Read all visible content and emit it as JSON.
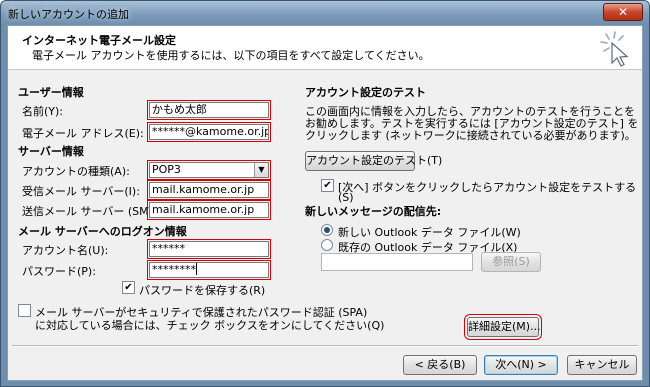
{
  "window": {
    "title": "新しいアカウントの追加",
    "close_glyph": "✕"
  },
  "header": {
    "title": "インターネット電子メール設定",
    "description": "電子メール アカウントを使用するには、以下の項目をすべて設定してください。",
    "icon": "cursor-sparkle-icon"
  },
  "user_info": {
    "heading": "ユーザー情報",
    "name_label": "名前(Y):",
    "name_value": "かもめ太郎",
    "email_label": "電子メール アドレス(E):",
    "email_value": "******@kamome.or.jp"
  },
  "server_info": {
    "heading": "サーバー情報",
    "account_type_label": "アカウントの種類(A):",
    "account_type_value": "POP3",
    "incoming_label": "受信メール サーバー(I):",
    "incoming_value": "mail.kamome.or.jp",
    "outgoing_label": "送信メール サーバー (SMTP)(O):",
    "outgoing_value": "mail.kamome.or.jp"
  },
  "logon_info": {
    "heading": "メール サーバーへのログオン情報",
    "account_name_label": "アカウント名(U):",
    "account_name_value": "******",
    "password_label": "パスワード(P):",
    "password_value": "********",
    "save_password_label": "パスワードを保存する(R)",
    "save_password_checked": true,
    "spa_label_line1": "メール サーバーがセキュリティで保護されたパスワード認証 (SPA)",
    "spa_label_line2": "に対応している場合には、チェック ボックスをオンにしてください(Q)",
    "spa_checked": false
  },
  "test": {
    "heading": "アカウント設定のテスト",
    "desc_line1": "この画面内に情報を入力したら、アカウントのテストを行うことを",
    "desc_line2": "お勧めします。テストを実行するには [アカウント設定のテスト] を",
    "desc_line3": "クリックします (ネットワークに接続されている必要があります)。",
    "test_button": "アカウント設定のテスト(T)",
    "auto_test_line1": "[次へ] ボタンをクリックしたらアカウント設定をテストする",
    "auto_test_line2": "(S)",
    "auto_test_checked": true
  },
  "delivery": {
    "heading": "新しいメッセージの配信先:",
    "new_file_label": "新しい Outlook データ ファイル(W)",
    "existing_file_label": "既存の Outlook データ ファイル(X)",
    "selected": "new",
    "path_value": "",
    "browse_button": "参照(S)"
  },
  "advanced_button": "詳細設定(M)...",
  "footer": {
    "back": "< 戻る(B)",
    "next": "次へ(N) >",
    "cancel": "キャンセル"
  }
}
